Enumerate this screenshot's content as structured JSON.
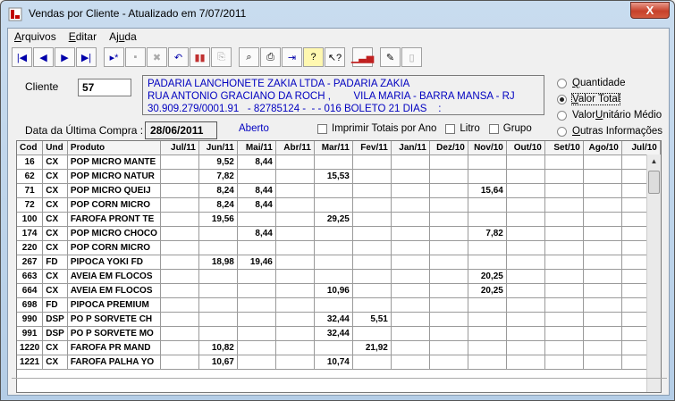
{
  "window": {
    "title": "Vendas por Cliente - Atualizado em  7/07/2011",
    "close": "X"
  },
  "menu": [
    {
      "pre": "",
      "u": "A",
      "post": "rquivos"
    },
    {
      "pre": "",
      "u": "E",
      "post": "ditar"
    },
    {
      "pre": "Aj",
      "u": "u",
      "post": "da"
    }
  ],
  "toolbar": {
    "first": "|◀",
    "prev": "◀",
    "next": "▶",
    "last": "▶|",
    "new": "▸*",
    "save": "▪",
    "delete": "✖",
    "undo": "↶",
    "books": "▮▮",
    "copy": "⎘",
    "find": "⌕",
    "print": "⎙",
    "export": "⇥",
    "help": "?",
    "whatsthis": "↖?",
    "chart": "▁▃▅",
    "notes": "✎",
    "blank": "▯"
  },
  "client": {
    "label": "Cliente",
    "code": "57",
    "address": [
      "PADARIA LANCHONETE ZAKIA LTDA - PADARIA ZAKIA",
      "RUA ANTONIO GRACIANO DA ROCH ,        VILA MARIA - BARRA MANSA - RJ",
      "30.909.279/0001.91   - 82785124 -  - - 016 BOLETO 21 DIAS    :"
    ]
  },
  "options": [
    {
      "pre": "",
      "u": "Q",
      "post": "uantidade",
      "selected": false
    },
    {
      "pre": "",
      "u": "V",
      "post": "alor Total",
      "selected": true
    },
    {
      "pre": "Valor ",
      "u": "U",
      "post": "nitário Médio",
      "selected": false
    },
    {
      "pre": "",
      "u": "O",
      "post": "utras Informações",
      "selected": false
    }
  ],
  "last_purchase": {
    "label": "Data da Última Compra :",
    "date": "28/06/2011",
    "status": "Aberto"
  },
  "checks": {
    "totais": "Imprimir Totais por Ano",
    "litro": "Litro",
    "grupo": "Grupo"
  },
  "table": {
    "headers": [
      "Cod",
      "Und",
      "Produto",
      "Jul/11",
      "Jun/11",
      "Mai/11",
      "Abr/11",
      "Mar/11",
      "Fev/11",
      "Jan/11",
      "Dez/10",
      "Nov/10",
      "Out/10",
      "Set/10",
      "Ago/10",
      "Jul/10"
    ],
    "rows": [
      [
        "16",
        "CX",
        "POP MICRO MANTE",
        "",
        "9,52",
        "8,44",
        "",
        "",
        "",
        "",
        "",
        "",
        "",
        "",
        "",
        ""
      ],
      [
        "62",
        "CX",
        "POP MICRO NATUR",
        "",
        "7,82",
        "",
        "",
        "15,53",
        "",
        "",
        "",
        "",
        "",
        "",
        "",
        ""
      ],
      [
        "71",
        "CX",
        "POP MICRO QUEIJ",
        "",
        "8,24",
        "8,44",
        "",
        "",
        "",
        "",
        "",
        "15,64",
        "",
        "",
        "",
        ""
      ],
      [
        "72",
        "CX",
        "POP CORN MICRO",
        "",
        "8,24",
        "8,44",
        "",
        "",
        "",
        "",
        "",
        "",
        "",
        "",
        "",
        ""
      ],
      [
        "100",
        "CX",
        "FAROFA PRONT TE",
        "",
        "19,56",
        "",
        "",
        "29,25",
        "",
        "",
        "",
        "",
        "",
        "",
        "",
        ""
      ],
      [
        "174",
        "CX",
        "POP MICRO CHOCO",
        "",
        "",
        "8,44",
        "",
        "",
        "",
        "",
        "",
        "7,82",
        "",
        "",
        "",
        ""
      ],
      [
        "220",
        "CX",
        "POP CORN MICRO",
        "",
        "",
        "",
        "",
        "",
        "",
        "",
        "",
        "",
        "",
        "",
        "",
        ""
      ],
      [
        "267",
        "FD",
        "PIPOCA YOKI FD",
        "",
        "18,98",
        "19,46",
        "",
        "",
        "",
        "",
        "",
        "",
        "",
        "",
        "",
        ""
      ],
      [
        "663",
        "CX",
        "AVEIA EM FLOCOS",
        "",
        "",
        "",
        "",
        "",
        "",
        "",
        "",
        "20,25",
        "",
        "",
        "",
        ""
      ],
      [
        "664",
        "CX",
        "AVEIA EM FLOCOS",
        "",
        "",
        "",
        "",
        "10,96",
        "",
        "",
        "",
        "20,25",
        "",
        "",
        "",
        ""
      ],
      [
        "698",
        "FD",
        "PIPOCA PREMIUM",
        "",
        "",
        "",
        "",
        "",
        "",
        "",
        "",
        "",
        "",
        "",
        "",
        ""
      ],
      [
        "990",
        "DSP",
        "PO P SORVETE CH",
        "",
        "",
        "",
        "",
        "32,44",
        "5,51",
        "",
        "",
        "",
        "",
        "",
        "",
        ""
      ],
      [
        "991",
        "DSP",
        "PO P SORVETE MO",
        "",
        "",
        "",
        "",
        "32,44",
        "",
        "",
        "",
        "",
        "",
        "",
        "",
        ""
      ],
      [
        "1220",
        "CX",
        "FAROFA PR MAND",
        "",
        "10,82",
        "",
        "",
        "",
        "21,92",
        "",
        "",
        "",
        "",
        "",
        "",
        ""
      ],
      [
        "1221",
        "CX",
        "FAROFA PALHA YO",
        "",
        "10,67",
        "",
        "",
        "10,74",
        "",
        "",
        "",
        "",
        "",
        "",
        "",
        ""
      ]
    ]
  }
}
